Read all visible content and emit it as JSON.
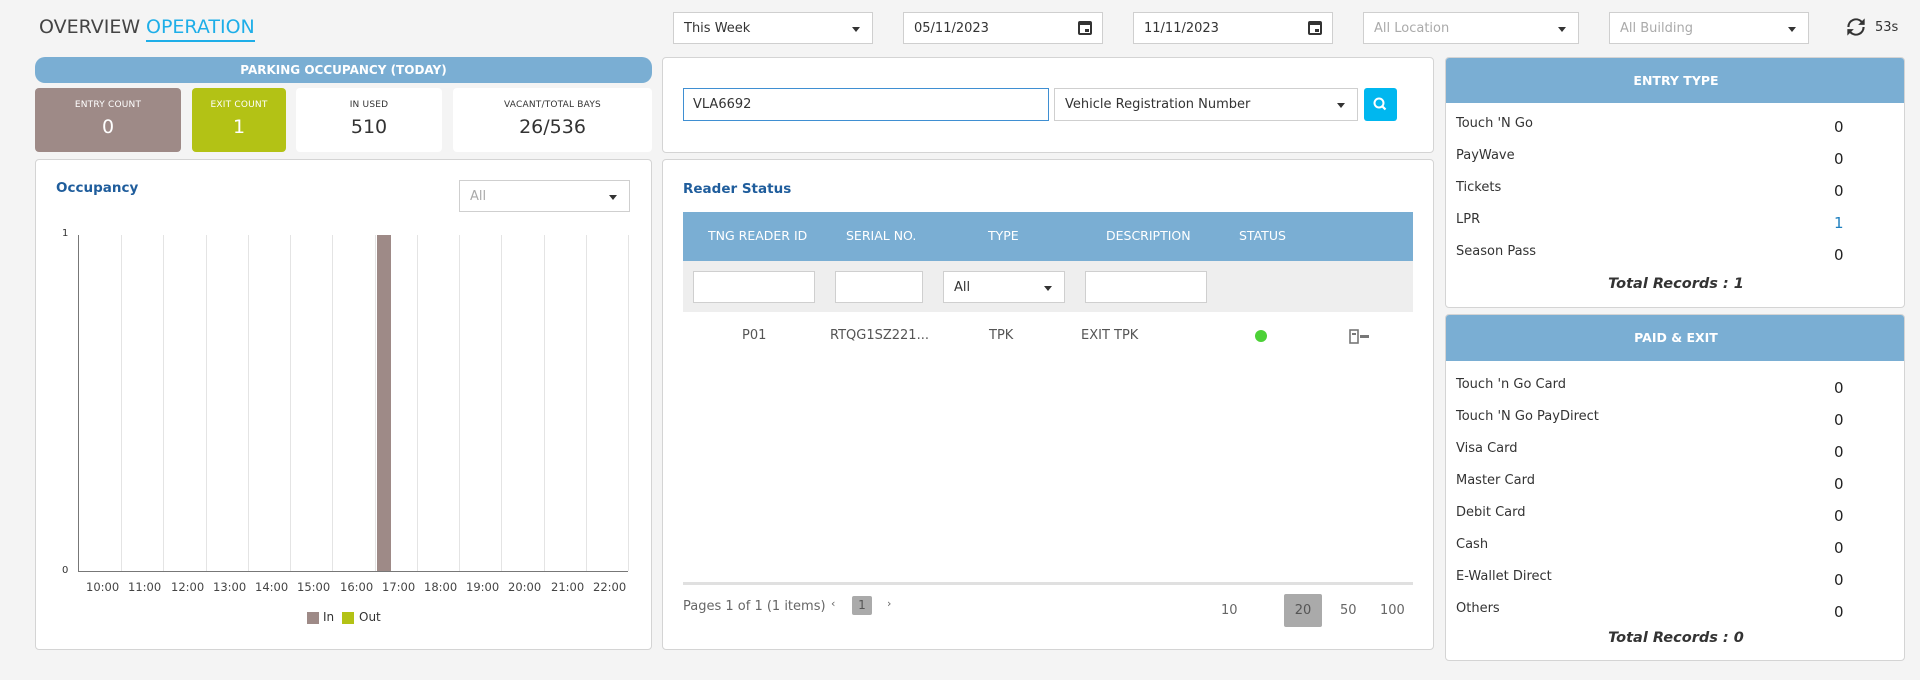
{
  "tabs": {
    "overview": "OVERVIEW",
    "operation": "OPERATION"
  },
  "filters": {
    "period": "This Week",
    "date_from": "05/11/2023",
    "date_to": "11/11/2023",
    "location_placeholder": "All Location",
    "building_placeholder": "All Building",
    "refresh_countdown": "53s"
  },
  "parking": {
    "title": "PARKING OCCUPANCY (TODAY)",
    "entry_label": "ENTRY COUNT",
    "entry_value": "0",
    "exit_label": "EXIT COUNT",
    "exit_value": "1",
    "inused_label": "IN USED",
    "inused_value": "510",
    "vacant_label": "VACANT/TOTAL BAYS",
    "vacant_value": "26/536"
  },
  "occupancy": {
    "title": "Occupancy",
    "filter": "All"
  },
  "chart_data": {
    "type": "bar",
    "title": "",
    "categories": [
      "10:00",
      "11:00",
      "12:00",
      "13:00",
      "14:00",
      "15:00",
      "16:00",
      "17:00",
      "18:00",
      "19:00",
      "20:00",
      "21:00",
      "22:00"
    ],
    "series": [
      {
        "name": "In",
        "color": "#9e8a87",
        "values": [
          0,
          0,
          0,
          0,
          0,
          0,
          0,
          1,
          0,
          0,
          0,
          0,
          0
        ]
      },
      {
        "name": "Out",
        "color": "#b3c215",
        "values": [
          0,
          0,
          0,
          0,
          0,
          0,
          0,
          0,
          0,
          0,
          0,
          0,
          0
        ]
      }
    ],
    "ylim": [
      0,
      1
    ],
    "yticks": [
      "0",
      "1"
    ],
    "legend": "bottom",
    "grid": true
  },
  "search": {
    "value": "VLA6692",
    "type": "Vehicle Registration Number"
  },
  "reader": {
    "title": "Reader Status",
    "columns": [
      "TNG READER ID",
      "SERIAL NO.",
      "TYPE",
      "DESCRIPTION",
      "STATUS"
    ],
    "type_filter": "All",
    "rows": [
      {
        "id": "P01",
        "serial": "RTQG1SZ221...",
        "type": "TPK",
        "description": "EXIT TPK",
        "status_color": "#4cd137"
      }
    ],
    "pager_text": "Pages 1 of 1 (1 items)",
    "current_page": "1",
    "page_sizes": [
      "10",
      "20",
      "50",
      "100"
    ],
    "selected_size": "20"
  },
  "entry_type": {
    "title": "ENTRY TYPE",
    "rows": [
      {
        "label": "Touch 'N Go",
        "value": "0"
      },
      {
        "label": "PayWave",
        "value": "0"
      },
      {
        "label": "Tickets",
        "value": "0"
      },
      {
        "label": "LPR",
        "value": "1"
      },
      {
        "label": "Season Pass",
        "value": "0"
      }
    ],
    "total": "Total Records : 1"
  },
  "paid_exit": {
    "title": "PAID & EXIT",
    "rows": [
      {
        "label": "Touch 'n Go Card",
        "value": "0"
      },
      {
        "label": "Touch 'N Go PayDirect",
        "value": "0"
      },
      {
        "label": "Visa Card",
        "value": "0"
      },
      {
        "label": "Master Card",
        "value": "0"
      },
      {
        "label": "Debit Card",
        "value": "0"
      },
      {
        "label": "Cash",
        "value": "0"
      },
      {
        "label": "E-Wallet Direct",
        "value": "0"
      },
      {
        "label": "Others",
        "value": "0"
      }
    ],
    "total": "Total Records : 0"
  },
  "colors": {
    "accent_blue": "#00b7ef",
    "header_blue": "#7aaed3",
    "entry_card": "#9e8a87",
    "exit_card": "#b3c215"
  }
}
